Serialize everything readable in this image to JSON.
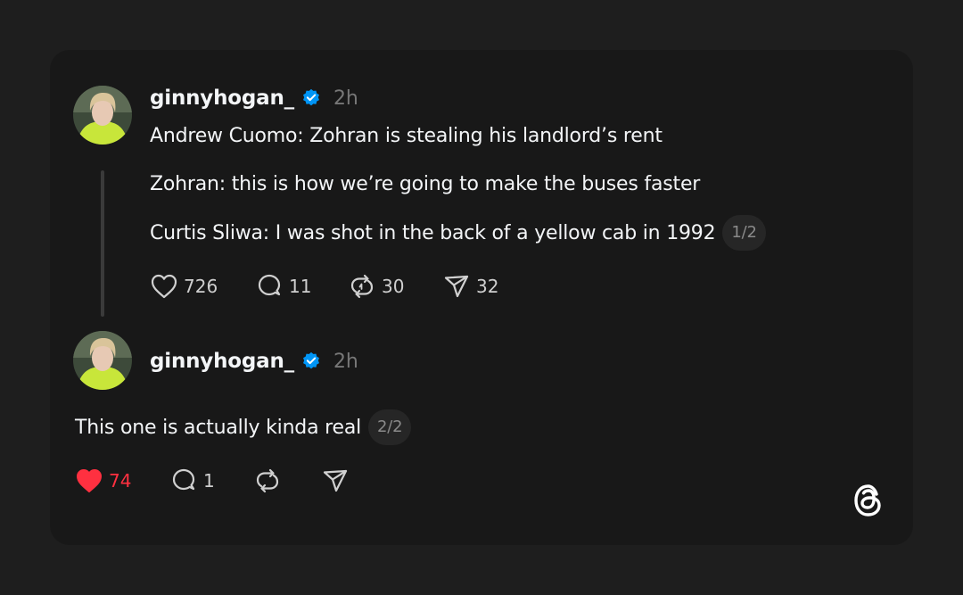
{
  "post1": {
    "username": "ginnyhogan_",
    "time": "2h",
    "lines": [
      "Andrew Cuomo: Zohran is stealing his landlord’s rent",
      "Zohran: this is how we’re going to make the buses faster",
      "Curtis Sliwa: I was shot in the back of a yellow cab in 1992"
    ],
    "pager": "1/2",
    "stats": {
      "likes": "726",
      "replies": "11",
      "reposts": "30",
      "shares": "32"
    }
  },
  "post2": {
    "username": "ginnyhogan_",
    "time": "2h",
    "text": "This one is actually kinda real",
    "pager": "2/2",
    "stats": {
      "likes": "74",
      "replies": "1"
    },
    "liked": true
  },
  "colors": {
    "background": "#1e1e1e",
    "card": "#181818",
    "verified": "#0095f6",
    "like_active": "#ff3040",
    "muted": "#777777"
  },
  "icons": [
    "heart-icon",
    "comment-icon",
    "repost-icon",
    "share-icon",
    "verified-badge-icon",
    "threads-logo-icon"
  ]
}
